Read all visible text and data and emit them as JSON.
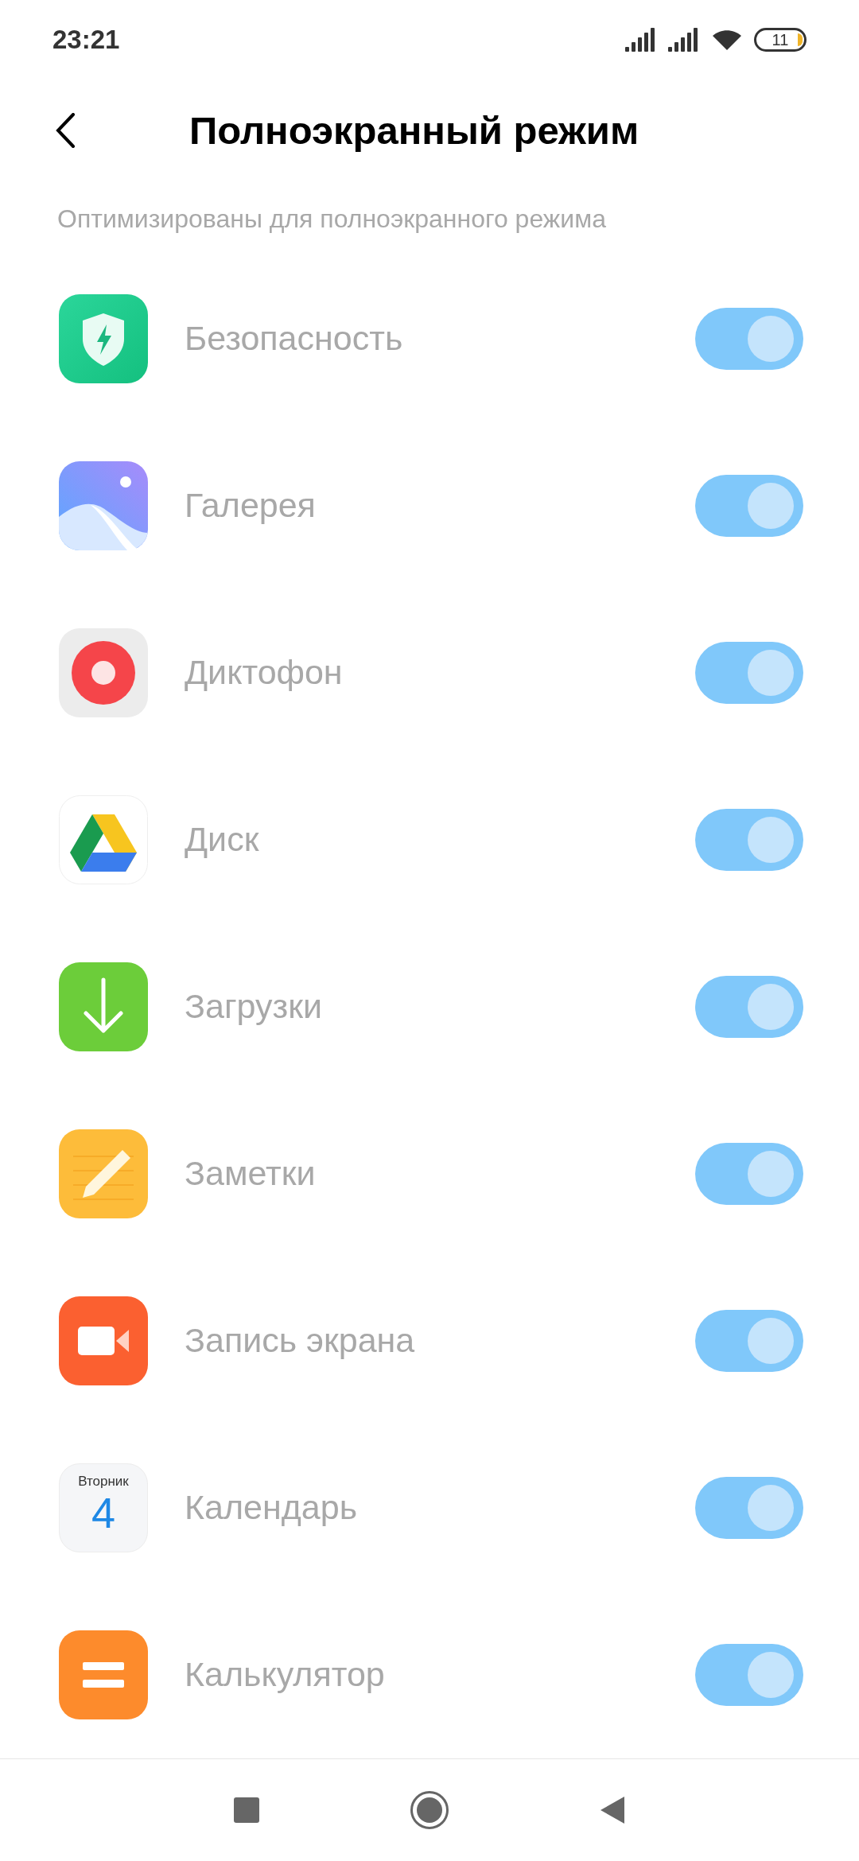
{
  "status_bar": {
    "time": "23:21",
    "battery": "11"
  },
  "header": {
    "title": "Полноэкранный режим"
  },
  "section": {
    "title": "Оптимизированы для полноэкранного режима"
  },
  "apps": [
    {
      "name": "Безопасность",
      "on": true,
      "disabled": true
    },
    {
      "name": "Галерея",
      "on": true,
      "disabled": true
    },
    {
      "name": "Диктофон",
      "on": true,
      "disabled": true
    },
    {
      "name": "Диск",
      "on": true,
      "disabled": true
    },
    {
      "name": "Загрузки",
      "on": true,
      "disabled": true
    },
    {
      "name": "Заметки",
      "on": true,
      "disabled": true
    },
    {
      "name": "Запись экрана",
      "on": true,
      "disabled": true
    },
    {
      "name": "Календарь",
      "on": true,
      "disabled": true,
      "icon_text": {
        "day": "Вторник",
        "date": "4"
      }
    },
    {
      "name": "Калькулятор",
      "on": true,
      "disabled": true
    }
  ]
}
